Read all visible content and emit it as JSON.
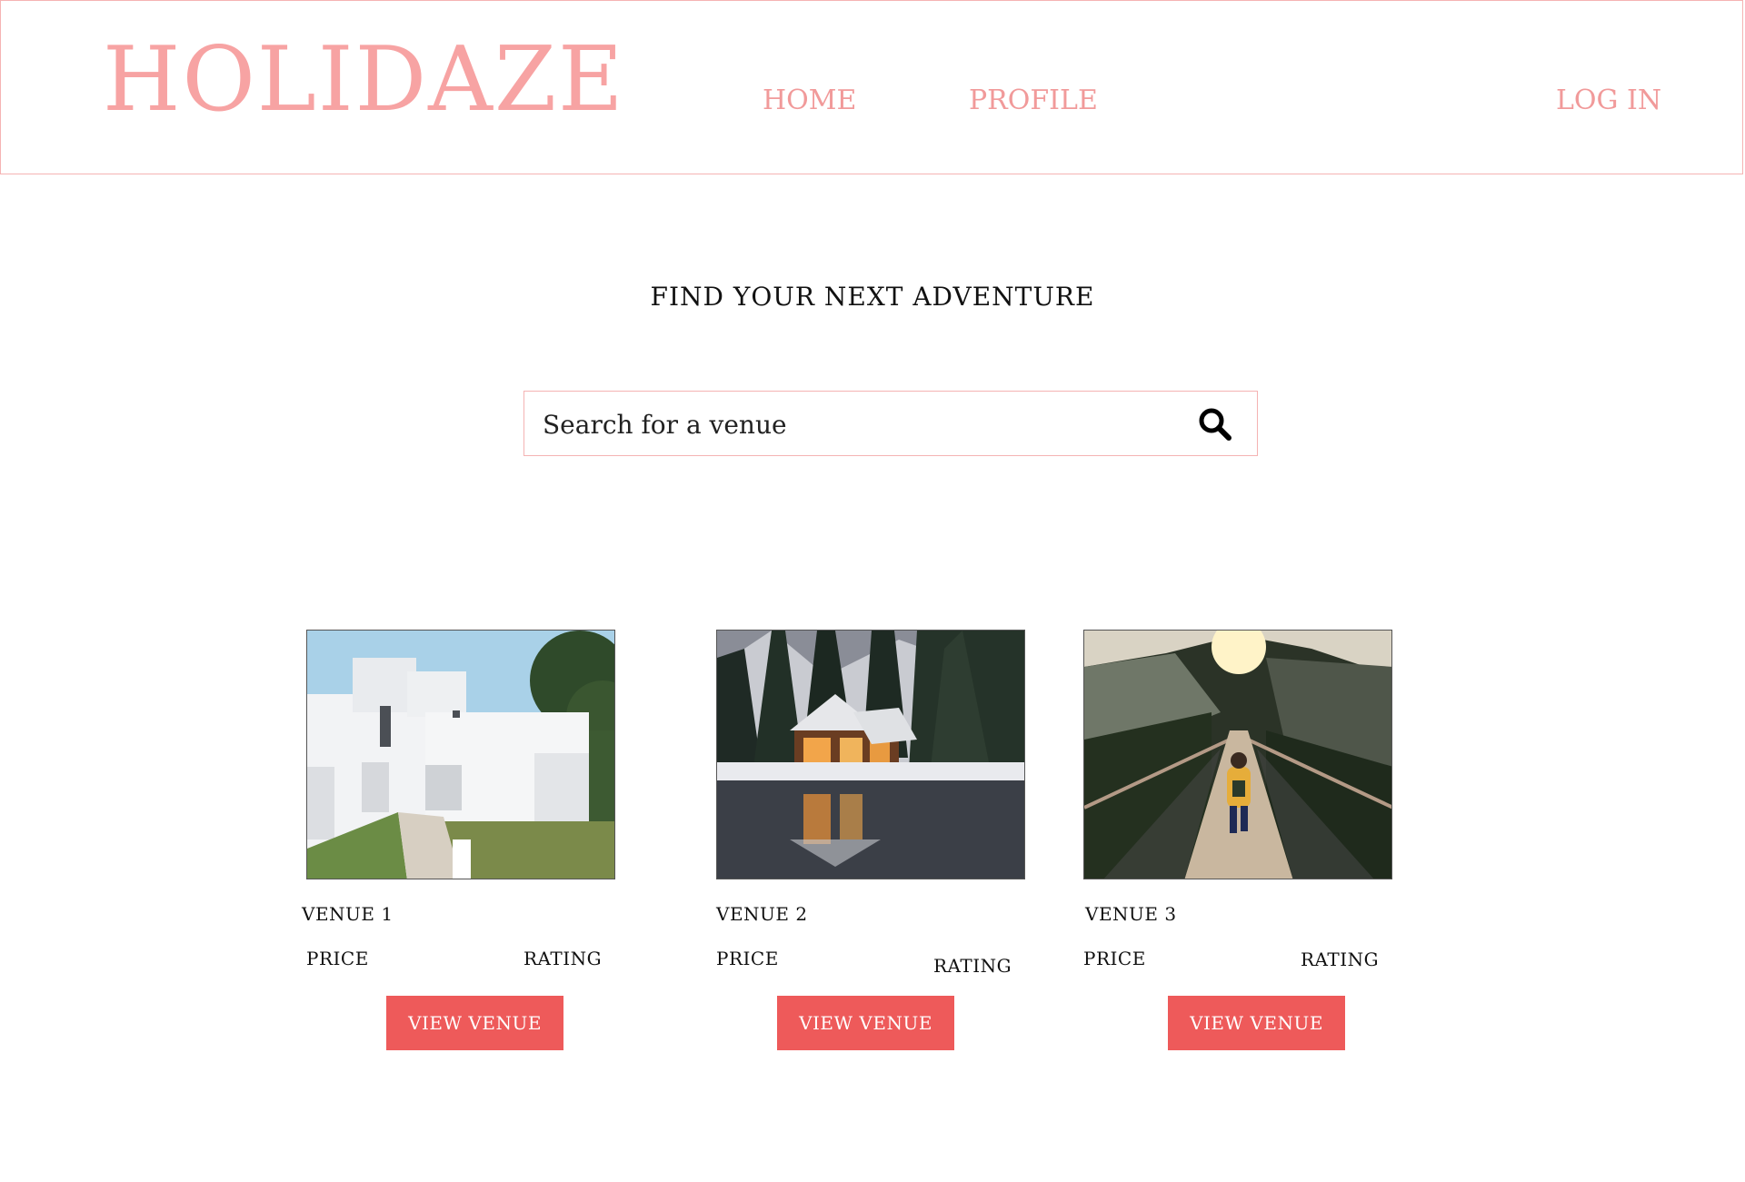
{
  "header": {
    "logo": "HOLIDAZE",
    "nav": {
      "home": "HOME",
      "profile": "PROFILE",
      "login": "LOG IN"
    }
  },
  "hero": {
    "title": "FIND YOUR NEXT ADVENTURE"
  },
  "search": {
    "placeholder": "Search for a venue",
    "icon": "search-icon"
  },
  "venues": [
    {
      "name": "VENUE 1",
      "price_label": "PRICE",
      "rating_label": "RATING",
      "button": "VIEW VENUE",
      "image": "white-modern-house-photo"
    },
    {
      "name": "VENUE 2",
      "price_label": "PRICE",
      "rating_label": "RATING",
      "button": "VIEW VENUE",
      "image": "snowy-lake-cabin-photo"
    },
    {
      "name": "VENUE 3",
      "price_label": "PRICE",
      "rating_label": "RATING",
      "button": "VIEW VENUE",
      "image": "suspension-bridge-hiker-photo"
    }
  ],
  "colors": {
    "brand": "#f7a3a3",
    "nav": "#f19a9a",
    "button": "#ee5a5a",
    "border": "#f5b3b3"
  }
}
